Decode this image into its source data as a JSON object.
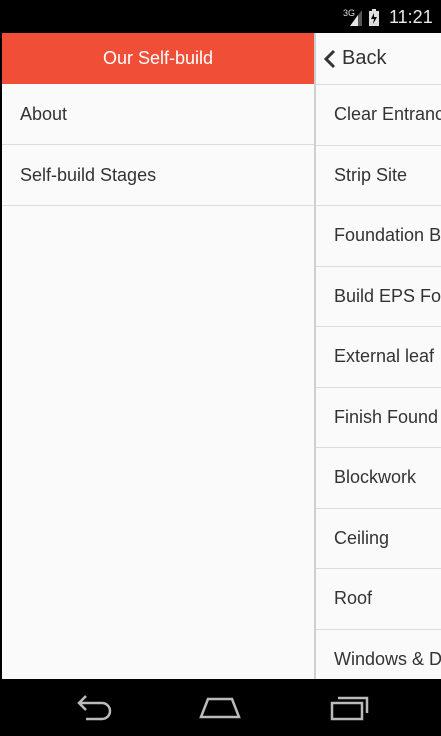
{
  "status_bar": {
    "network": "3G",
    "time": "11:21",
    "icons": [
      "signal-icon",
      "battery-icon"
    ]
  },
  "drawer": {
    "header_title": "Our Self-build",
    "items": [
      {
        "label": "About"
      },
      {
        "label": "Self-build Stages"
      }
    ],
    "header_color": "#f04e37"
  },
  "stages_panel": {
    "back_label": "Back",
    "items": [
      {
        "label": "Clear Entrance"
      },
      {
        "label": "Strip Site"
      },
      {
        "label": "Foundation B"
      },
      {
        "label": "Build EPS Fo"
      },
      {
        "label": "External leaf"
      },
      {
        "label": "Finish Found"
      },
      {
        "label": "Blockwork"
      },
      {
        "label": "Ceiling"
      },
      {
        "label": "Roof"
      },
      {
        "label": "Windows & D"
      }
    ]
  },
  "nav_bar": {
    "icons": [
      "back-icon",
      "home-icon",
      "recent-apps-icon"
    ]
  }
}
